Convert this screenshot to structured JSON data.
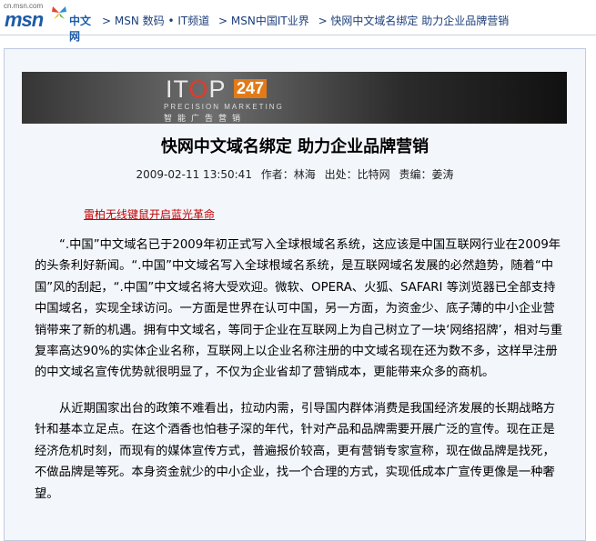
{
  "header": {
    "logo_small": "cn.msn.com",
    "logo_msn": "msn",
    "logo_cn": "中文网",
    "breadcrumbs": [
      "> MSN 数码 • IT频道",
      "> MSN中国IT业界",
      "> 快网中文域名绑定 助力企业品牌营销"
    ]
  },
  "banner": {
    "it": "IT",
    "o": "O",
    "p": "P",
    "badge": "247",
    "sub": "PRECISION MARKETING",
    "cn": "智能广告营销"
  },
  "article": {
    "title": "快网中文域名绑定 助力企业品牌营销",
    "date": "2009-02-11 13:50:41",
    "author": "作者：林海",
    "source": "出处：比特网",
    "editor": "责编：姜涛",
    "promo_link": "雷柏无线键鼠开启蓝光革命",
    "paragraphs": [
      "“.中国”中文域名已于2009年初正式写入全球根域名系统，这应该是中国互联网行业在2009年的头条利好新闻。“.中国”中文域名写入全球根域名系统，是互联网域名发展的必然趋势，随着“中国”风的刮起，“.中国”中文域名将大受欢迎。微软、OPERA、火狐、SAFARI 等浏览器已全部支持中国域名，实现全球访问。一方面是世界在认可中国，另一方面，为资金少、底子薄的中小企业营销带来了新的机遇。拥有中文域名，等同于企业在互联网上为自己树立了一块‘网络招牌’，相对与重复率高达90%的实体企业名称，互联网上以企业名称注册的中文域名现在还为数不多，这样早注册的中文域名宣传优势就很明显了，不仅为企业省却了营销成本，更能带来众多的商机。",
      "从近期国家出台的政策不难看出，拉动内需，引导国内群体消费是我国经济发展的长期战略方针和基本立足点。在这个酒香也怕巷子深的年代，针对产品和品牌需要开展广泛的宣传。现在正是经济危机时刻，而现有的媒体宣传方式，普遍报价较高，更有营销专家宣称，现在做品牌是找死，不做品牌是等死。本身资金就少的中小企业，找一个合理的方式，实现低成本广宣传更像是一种奢望。"
    ]
  }
}
